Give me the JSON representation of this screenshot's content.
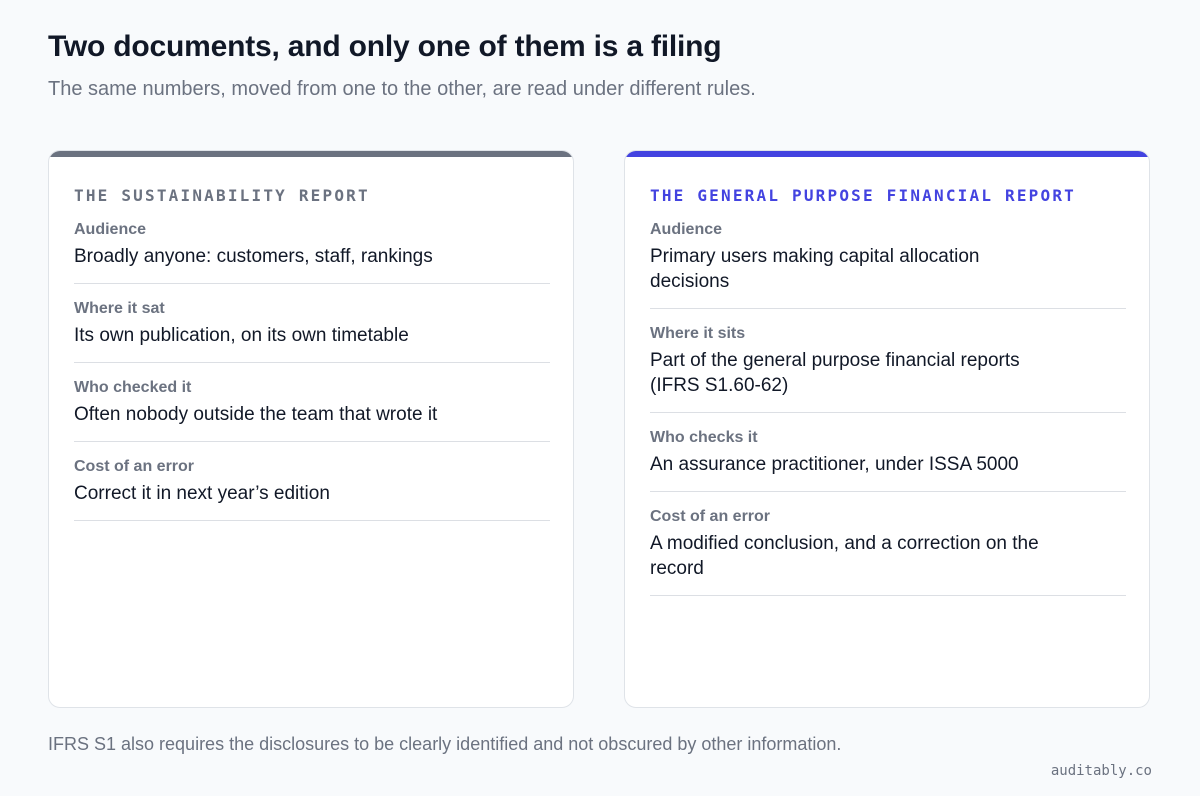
{
  "header": {
    "title": "Two documents, and only one of them is a filing",
    "subtitle": "The same numbers, moved from one to the other, are read under different rules."
  },
  "cards": [
    {
      "heading": "THE SUSTAINABILITY REPORT",
      "accent_color": "#6b7280",
      "rows": [
        {
          "label": "Audience",
          "value": "Broadly anyone: customers, staff, rankings"
        },
        {
          "label": "Where it sat",
          "value": "Its own publication, on its own timetable"
        },
        {
          "label": "Who checked it",
          "value": "Often nobody outside the team that wrote it"
        },
        {
          "label": "Cost of an error",
          "value": "Correct it in next year’s edition"
        }
      ]
    },
    {
      "heading": "THE GENERAL PURPOSE FINANCIAL REPORT",
      "accent_color": "#4343e0",
      "rows": [
        {
          "label": "Audience",
          "value": "Primary users making capital allocation decisions"
        },
        {
          "label": "Where it sits",
          "value": "Part of the general purpose financial reports (IFRS S1.60-62)"
        },
        {
          "label": "Who checks it",
          "value": "An assurance practitioner, under ISSA 5000"
        },
        {
          "label": "Cost of an error",
          "value": "A modified conclusion, and a correction on the record"
        }
      ]
    }
  ],
  "footer": {
    "note": "IFRS S1 also requires the disclosures to be clearly identified and not obscured by other information.",
    "brand": "auditably.co"
  }
}
